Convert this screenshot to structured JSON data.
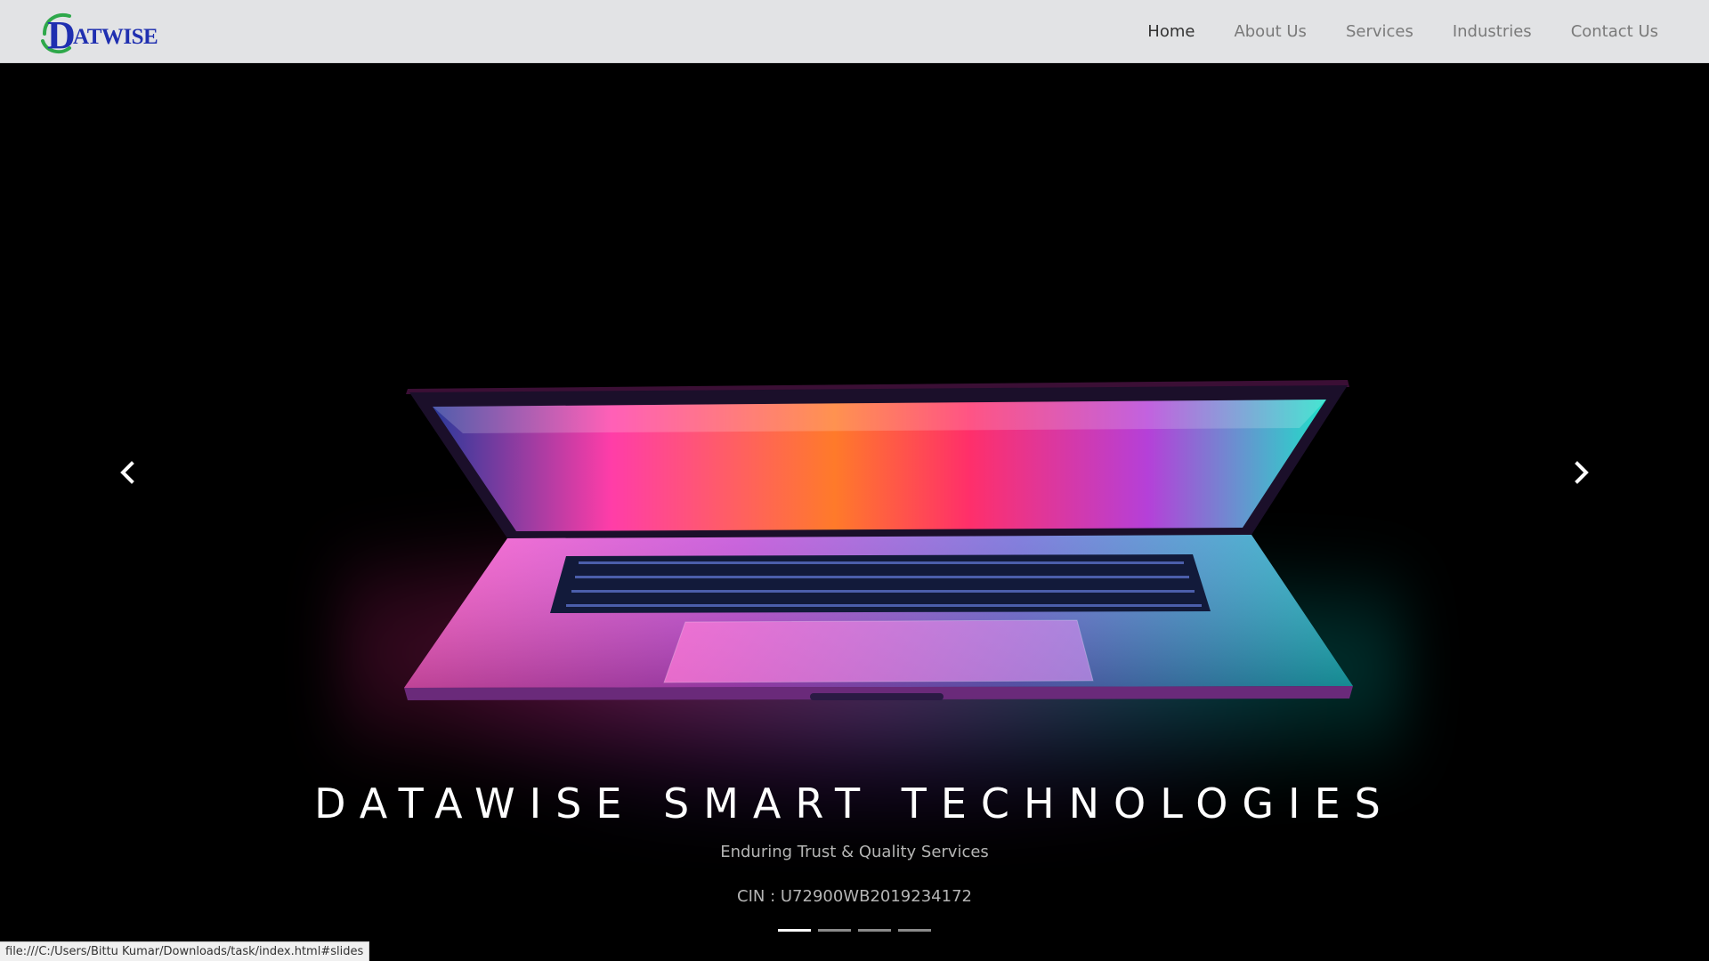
{
  "brand": {
    "logo_text": "ATWISE",
    "logo_letter": "D"
  },
  "nav": {
    "items": [
      {
        "label": "Home",
        "active": true
      },
      {
        "label": "About Us",
        "active": false
      },
      {
        "label": "Services",
        "active": false
      },
      {
        "label": "Industries",
        "active": false
      },
      {
        "label": "Contact Us",
        "active": false
      }
    ]
  },
  "hero": {
    "title": "DATAWISE SMART TECHNOLOGIES",
    "subtitle": "Enduring Trust & Quality Services",
    "cin": "CIN : U72900WB2019234172",
    "slides_count": 4,
    "active_slide": 1,
    "prev_icon": "chevron-left-icon",
    "next_icon": "chevron-right-icon",
    "image": "laptop-neon-image"
  },
  "status_bar": {
    "url": "file:///C:/Users/Bittu Kumar/Downloads/task/index.html#slides"
  },
  "colors": {
    "navbar_bg": "#e2e3e5",
    "brand_blue": "#1f2fb0",
    "brand_green": "#2ea84a",
    "hero_bg": "#000000",
    "nav_active": "#333333",
    "nav_inactive": "#7a7a7a"
  }
}
